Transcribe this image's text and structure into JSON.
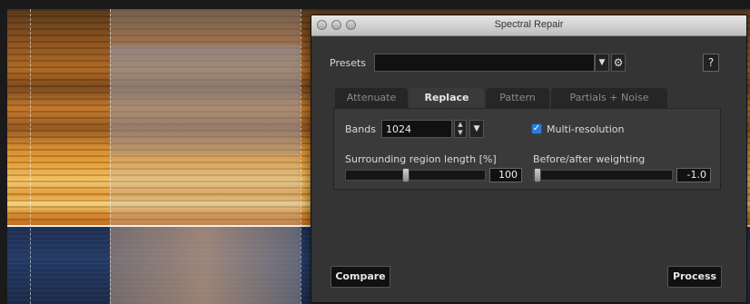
{
  "window": {
    "title": "Spectral Repair"
  },
  "presets": {
    "label": "Presets",
    "value": "",
    "help": "?"
  },
  "tabs": [
    {
      "label": "Attenuate",
      "active": false
    },
    {
      "label": "Replace",
      "active": true
    },
    {
      "label": "Pattern",
      "active": false
    },
    {
      "label": "Partials + Noise",
      "active": false
    }
  ],
  "settings": {
    "bands_label": "Bands",
    "bands_value": "1024",
    "multi_resolution_label": "Multi-resolution",
    "multi_resolution_checked": true,
    "surrounding_label": "Surrounding region length [%]",
    "surrounding_value": "100",
    "surrounding_fraction": 0.35,
    "weighting_label": "Before/after weighting",
    "weighting_value": "-1.0",
    "weighting_fraction": 0.0
  },
  "buttons": {
    "compare": "Compare",
    "process": "Process"
  },
  "icons": {
    "dropdown": "chevron-down-icon",
    "gear": "gear-icon",
    "stepper": "stepper-icon",
    "check": "checkmark-icon"
  },
  "colors": {
    "accent": "#2c7be0",
    "dialog_bg": "#343434",
    "panel_bg": "#3a3a3a"
  }
}
